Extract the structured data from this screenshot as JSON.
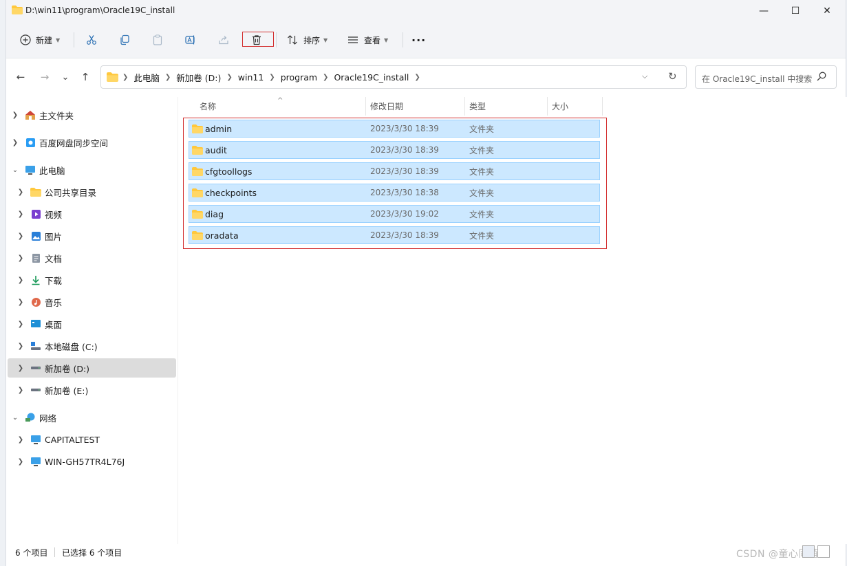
{
  "window": {
    "title": "D:\\win11\\program\\Oracle19C_install",
    "minimize": "—",
    "maximize": "☐",
    "close": "✕"
  },
  "toolbar": {
    "new_label": "新建",
    "sort_label": "排序",
    "view_label": "查看",
    "more_label": "···"
  },
  "nav": {
    "back": "←",
    "forward": "→",
    "recent": "⌄",
    "up": "↑"
  },
  "address": {
    "crumbs": [
      "此电脑",
      "新加卷 (D:)",
      "win11",
      "program",
      "Oracle19C_install"
    ]
  },
  "search": {
    "placeholder": "在 Oracle19C_install 中搜索"
  },
  "sidebar": {
    "items": [
      {
        "label": "主文件夹",
        "icon": "home-icon"
      },
      {
        "label": "百度网盘同步空间",
        "icon": "cloud-icon"
      },
      {
        "label": "此电脑",
        "icon": "pc-icon"
      },
      {
        "label": "公司共享目录",
        "icon": "folder-icon"
      },
      {
        "label": "视频",
        "icon": "video-icon"
      },
      {
        "label": "图片",
        "icon": "picture-icon"
      },
      {
        "label": "文档",
        "icon": "document-icon"
      },
      {
        "label": "下载",
        "icon": "download-icon"
      },
      {
        "label": "音乐",
        "icon": "music-icon"
      },
      {
        "label": "桌面",
        "icon": "desktop-icon"
      },
      {
        "label": "本地磁盘 (C:)",
        "icon": "system-drive-icon"
      },
      {
        "label": "新加卷 (D:)",
        "icon": "drive-icon"
      },
      {
        "label": "新加卷 (E:)",
        "icon": "drive-icon"
      },
      {
        "label": "网络",
        "icon": "network-icon"
      },
      {
        "label": "CAPITALTEST",
        "icon": "computer-icon"
      },
      {
        "label": "WIN-GH57TR4L76J",
        "icon": "computer-icon"
      }
    ]
  },
  "columns": {
    "name": "名称",
    "modified": "修改日期",
    "type": "类型",
    "size": "大小",
    "sort_indicator": "^"
  },
  "files": [
    {
      "name": "admin",
      "modified": "2023/3/30 18:39",
      "type": "文件夹"
    },
    {
      "name": "audit",
      "modified": "2023/3/30 18:39",
      "type": "文件夹"
    },
    {
      "name": "cfgtoollogs",
      "modified": "2023/3/30 18:39",
      "type": "文件夹"
    },
    {
      "name": "checkpoints",
      "modified": "2023/3/30 18:38",
      "type": "文件夹"
    },
    {
      "name": "diag",
      "modified": "2023/3/30 19:02",
      "type": "文件夹"
    },
    {
      "name": "oradata",
      "modified": "2023/3/30 18:39",
      "type": "文件夹"
    }
  ],
  "status": {
    "count": "6 个项目",
    "selected": "已选择 6 个项目"
  },
  "watermark": "CSDN @童心同萌",
  "colors": {
    "selection_fill": "#cce8ff",
    "selection_border": "#99d1ff",
    "highlight_red": "#d32f2f",
    "folder_yellow": "#ffc83d"
  }
}
